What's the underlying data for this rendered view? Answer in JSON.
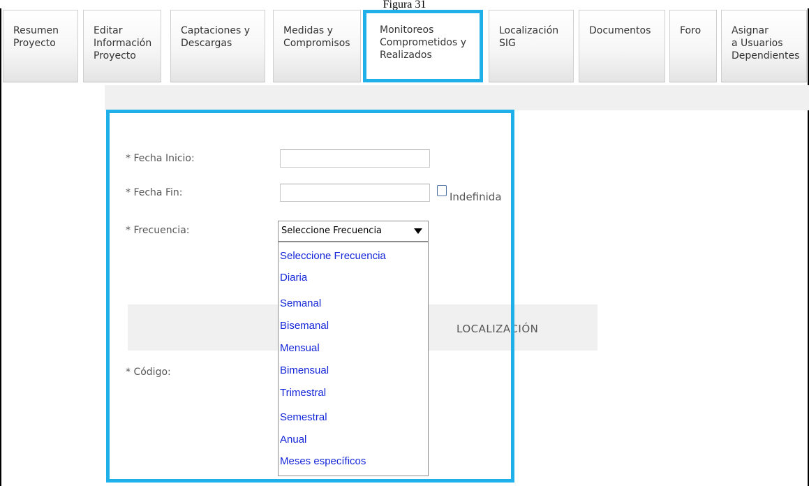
{
  "caption": "Figura 31",
  "tabs": [
    {
      "label": "Resumen\nProyecto"
    },
    {
      "label": "Editar\nInformación\nProyecto"
    },
    {
      "label": "Captaciones y\nDescargas"
    },
    {
      "label": "Medidas y\nCompromisos"
    },
    {
      "label": "Monitoreos\nComprometidos y\nRealizados"
    },
    {
      "label": "Localización\nSIG"
    },
    {
      "label": "Documentos"
    },
    {
      "label": "Foro"
    },
    {
      "label": "Asignar\na Usuarios\nDependientes"
    }
  ],
  "form": {
    "fecha_inicio_label": "* Fecha Inicio:",
    "fecha_inicio_value": "",
    "fecha_fin_label": "* Fecha Fin:",
    "fecha_fin_value": "",
    "indefinida_label": "Indefinida",
    "frecuencia_label": "* Frecuencia:",
    "frecuencia_selected": "Seleccione Frecuencia",
    "codigo_label": "* Código:"
  },
  "section_title": "LOCALIZACIÓN",
  "frequency_options": [
    "Seleccione Frecuencia",
    "Diaria",
    "Semanal",
    "Bisemanal",
    "Mensual",
    "Bimensual",
    "Trimestral",
    "Semestral",
    "Anual",
    "Meses específicos"
  ],
  "colors": {
    "highlight": "#1fb0ea",
    "option_text": "#1426d8"
  }
}
